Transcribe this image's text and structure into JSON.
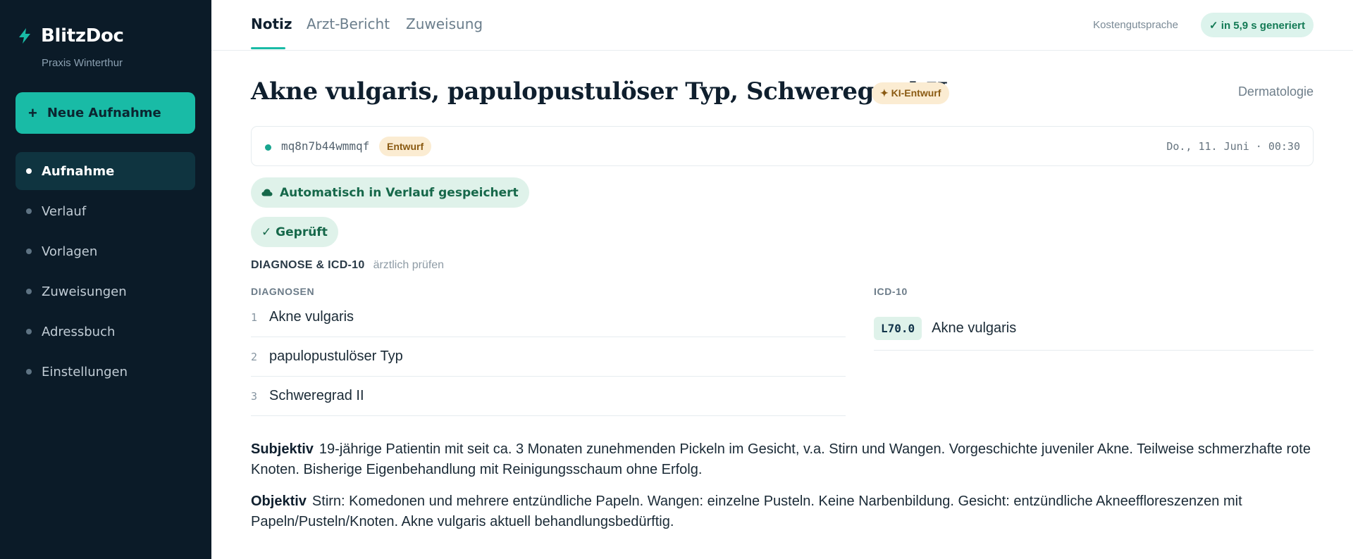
{
  "app": {
    "name": "BlitzDoc",
    "practice": "Praxis Winterthur"
  },
  "sidebar": {
    "new_button": {
      "icon": "+",
      "label": "Neue Aufnahme"
    },
    "items": [
      {
        "label": "Aufnahme",
        "active": true
      },
      {
        "label": "Verlauf",
        "active": false
      },
      {
        "label": "Vorlagen",
        "active": false
      },
      {
        "label": "Zuweisungen",
        "active": false
      },
      {
        "label": "Adressbuch",
        "active": false
      },
      {
        "label": "Einstellungen",
        "active": false
      }
    ]
  },
  "header": {
    "tabs": [
      {
        "label": "Notiz",
        "active": true
      },
      {
        "label": "Arzt-Bericht",
        "active": false
      },
      {
        "label": "Zuweisung",
        "active": false
      }
    ],
    "cost_link": "Kostengutsprache",
    "generated_badge": "✓ in 5,9 s generiert"
  },
  "note": {
    "title": "Akne vulgaris, papulopustulöser Typ, Schweregrad II",
    "ki_badge": "✦ KI-Entwurf",
    "specialty": "Dermatologie",
    "record": {
      "id": "mq8n7b44wmmqf",
      "status": "Entwurf",
      "datetime": "Do., 11. Juni · 00:30"
    },
    "autosave_label": "Automatisch in Verlauf gespeichert",
    "checked_label": "✓ Geprüft",
    "diagnosis_section": {
      "title": "DIAGNOSE & ICD-10",
      "hint": "ärztlich prüfen",
      "diagnoses_header": "DIAGNOSEN",
      "icd_header": "ICD-10",
      "diagnoses": [
        {
          "num": "1",
          "text": "Akne vulgaris"
        },
        {
          "num": "2",
          "text": "papulopustulöser Typ"
        },
        {
          "num": "3",
          "text": "Schweregrad II"
        }
      ],
      "icd": [
        {
          "code": "L70.0",
          "text": "Akne vulgaris"
        }
      ]
    },
    "subjective": {
      "label": "Subjektiv",
      "text": "19-jährige Patientin mit seit ca. 3 Monaten zunehmenden Pickeln im Gesicht, v.a. Stirn und Wangen. Vorgeschichte juveniler Akne. Teilweise schmerzhafte rote Knoten. Bisherige Eigenbehandlung mit Reinigungsschaum ohne Erfolg."
    },
    "objective": {
      "label": "Objektiv",
      "text": "Stirn: Komedonen und mehrere entzündliche Papeln. Wangen: einzelne Pusteln. Keine Narbenbildung. Gesicht: entzündliche Akneeffloreszenzen mit Papeln/Pusteln/Knoten. Akne vulgaris aktuell behandlungsbedürftig."
    }
  },
  "colors": {
    "sidebar_bg": "#0b1b28",
    "accent": "#19bba6",
    "success_bg": "#dff2ea",
    "draft_bg": "#fbecd2"
  }
}
